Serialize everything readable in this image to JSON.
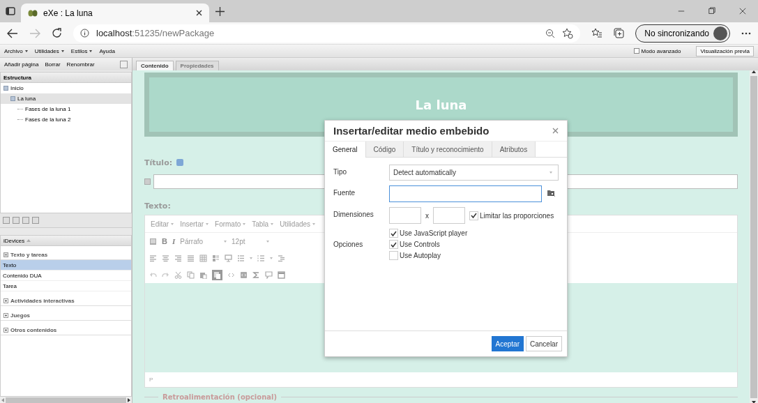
{
  "browser": {
    "tab_title": "eXe : La luna",
    "url_host": "localhost",
    "url_rest": ":51235/newPackage",
    "profile_label": "No sincronizando"
  },
  "menu_bar": {
    "items": [
      {
        "label": "Archivo",
        "has_menu": true
      },
      {
        "label": "Utilidades",
        "has_menu": true
      },
      {
        "label": "Estilos",
        "has_menu": true
      },
      {
        "label": "Ayuda",
        "has_menu": false
      }
    ],
    "advanced_mode": {
      "label": "Modo avanzado",
      "checked": false
    },
    "preview_button": "Visualización previa"
  },
  "page_toolbar": [
    "Añadir página",
    "Borrar",
    "Renombrar"
  ],
  "structure": {
    "title": "Estructura",
    "tree": [
      {
        "label": "Inicio",
        "expanded": true,
        "selected": false,
        "children": [
          {
            "label": "La luna",
            "expanded": true,
            "selected": true,
            "children": [
              {
                "label": "Fases de la luna 1",
                "selected": false
              },
              {
                "label": "Fases de la luna 2",
                "selected": false
              }
            ]
          }
        ]
      }
    ]
  },
  "idevices": {
    "title": "iDevices",
    "categories": [
      {
        "label": "Texto y tareas",
        "expanded": true,
        "items": [
          {
            "label": "Texto",
            "selected": true
          },
          {
            "label": "Contenido DUA",
            "selected": false
          },
          {
            "label": "Tarea",
            "selected": false
          }
        ]
      },
      {
        "label": "Actividades interactivas",
        "expanded": false
      },
      {
        "label": "Juegos",
        "expanded": false
      },
      {
        "label": "Otros contenidos",
        "expanded": false
      }
    ]
  },
  "content_tabs": [
    {
      "label": "Contenido",
      "selected": true
    },
    {
      "label": "Propiedades",
      "selected": false
    }
  ],
  "page_header": "La luna",
  "form": {
    "title_label": "Título:",
    "text_label": "Texto:",
    "editor_menu": [
      "Editar",
      "Insertar",
      "Formato",
      "Tabla",
      "Utilidades"
    ],
    "bold_glyph": "B",
    "italic_glyph": "I",
    "format_select": "Párrafo",
    "size_select": "12pt",
    "status_path": "P",
    "feedback_label": "Retroalimentación (opcional)"
  },
  "dialog": {
    "title": "Insertar/editar medio embebido",
    "tabs": [
      {
        "label": "General",
        "selected": true
      },
      {
        "label": "Código",
        "selected": false
      },
      {
        "label": "Título y reconocimiento",
        "selected": false
      },
      {
        "label": "Atributos",
        "selected": false
      }
    ],
    "type_label": "Tipo",
    "type_value": "Detect automatically",
    "source_label": "Fuente",
    "dimensions_label": "Dimensiones",
    "dimensions_separator": "x",
    "constrain": {
      "label": "Limitar las proporciones",
      "checked": true
    },
    "options_label": "Opciones",
    "options": [
      {
        "label": "Use JavaScript player",
        "checked": true
      },
      {
        "label": "Use Controls",
        "checked": true
      },
      {
        "label": "Use Autoplay",
        "checked": false
      }
    ],
    "buttons": [
      {
        "label": "Aceptar",
        "kind": "primary"
      },
      {
        "label": "Cancelar",
        "kind": "secondary"
      }
    ]
  }
}
